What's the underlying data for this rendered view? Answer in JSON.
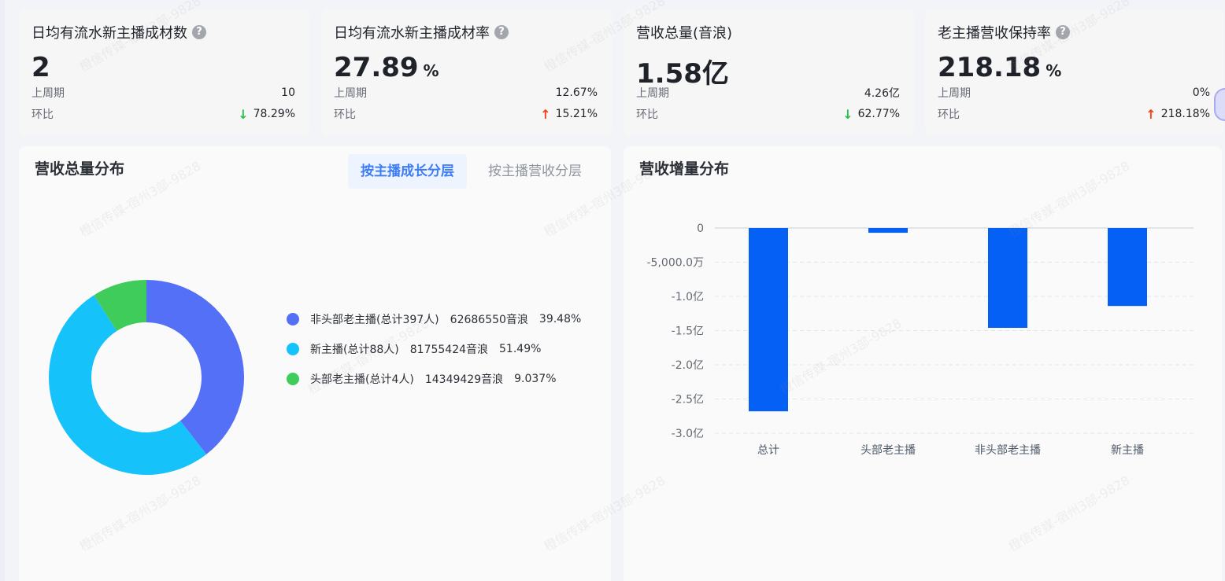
{
  "cards": [
    {
      "title": "日均有流水新主播成材数",
      "has_help": true,
      "value": "2",
      "unit": "",
      "prev_label": "上周期",
      "prev_value": "10",
      "ratio_label": "环比",
      "ratio_value": "78.29%",
      "ratio_dir": "down"
    },
    {
      "title": "日均有流水新主播成材率",
      "has_help": true,
      "value": "27.89",
      "unit": "%",
      "prev_label": "上周期",
      "prev_value": "12.67%",
      "ratio_label": "环比",
      "ratio_value": "15.21%",
      "ratio_dir": "up"
    },
    {
      "title": "营收总量(音浪)",
      "has_help": false,
      "value": "1.58亿",
      "unit": "",
      "prev_label": "上周期",
      "prev_value": "4.26亿",
      "ratio_label": "环比",
      "ratio_value": "62.77%",
      "ratio_dir": "down"
    },
    {
      "title": "老主播营收保持率",
      "has_help": true,
      "value": "218.18",
      "unit": "%",
      "prev_label": "上周期",
      "prev_value": "0%",
      "ratio_label": "环比",
      "ratio_value": "218.18%",
      "ratio_dir": "up"
    }
  ],
  "help_glyph": "?",
  "arrows": {
    "down": "↓",
    "up": "↑"
  },
  "left_panel": {
    "title": "营收总量分布",
    "tabs": [
      {
        "label": "按主播成长分层",
        "active": true
      },
      {
        "label": "按主播营收分层",
        "active": false
      }
    ]
  },
  "right_panel": {
    "title": "营收增量分布"
  },
  "chart_data": [
    {
      "type": "pie",
      "title": "",
      "donut": true,
      "categories": [
        "非头部老主播(总计397人)",
        "新主播(总计88人)",
        "头部老主播(总计4人)"
      ],
      "values": [
        62686550,
        81755424,
        14349429
      ],
      "value_labels": [
        "62686550音浪",
        "81755424音浪",
        "14349429音浪"
      ],
      "percent_labels": [
        "39.48%",
        "51.49%",
        "9.037%"
      ],
      "colors": [
        "#5470f6",
        "#16c2fa",
        "#3fcc5a"
      ],
      "legend_position": "right"
    },
    {
      "type": "bar",
      "title": "",
      "categories": [
        "总计",
        "头部老主播",
        "非头部老主播",
        "新主播"
      ],
      "values": [
        -268000000,
        -7000000,
        -146000000,
        -114000000
      ],
      "ylim": [
        -300000000,
        0
      ],
      "ytick_values": [
        0,
        -50000000,
        -100000000,
        -150000000,
        -200000000,
        -250000000,
        -300000000
      ],
      "ytick_labels": [
        "0",
        "-5,000.0万",
        "-1.0亿",
        "-1.5亿",
        "-2.0亿",
        "-2.5亿",
        "-3.0亿"
      ],
      "color": "#0560f5",
      "grid": true
    }
  ],
  "watermark": "橙信传媒-宿州3部-9828"
}
